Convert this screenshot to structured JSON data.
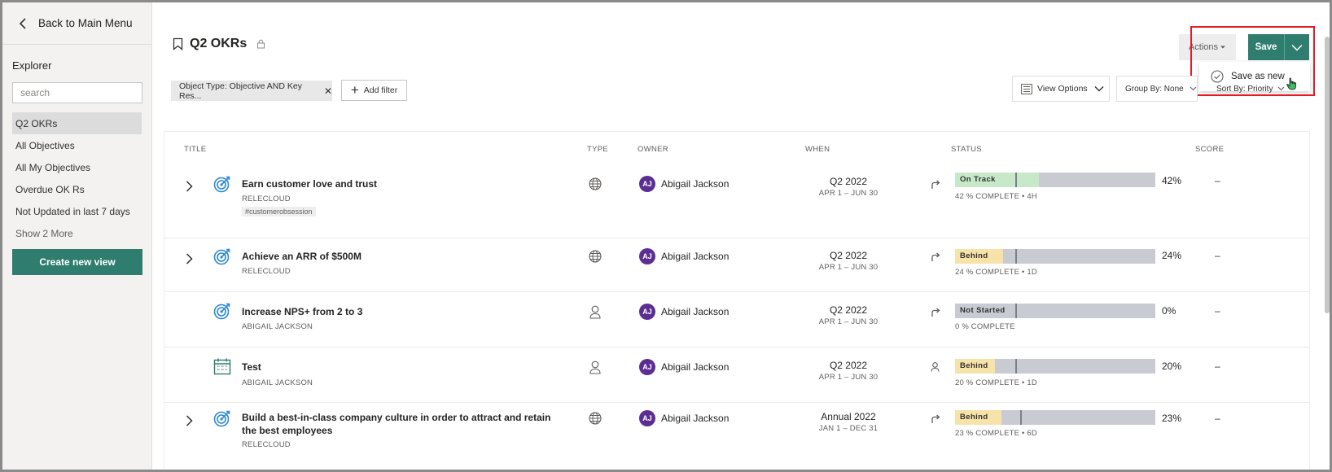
{
  "sidebar": {
    "back_label": "Back to Main Menu",
    "explorer_title": "Explorer",
    "search_placeholder": "search",
    "views": [
      "Q2 OKRs",
      "All Objectives",
      "All My Objectives",
      "Overdue OK Rs",
      "Not Updated in last 7 days"
    ],
    "show_more": "Show 2 More",
    "create_view": "Create new view"
  },
  "header": {
    "title": "Q2 OKRs",
    "actions": "Actions",
    "save": "Save",
    "save_as_new": "Save as new",
    "filter_chip": "Object Type: Objective AND Key Res...",
    "add_filter": "Add filter",
    "view_options": "View Options",
    "group_by": "Group By: None",
    "sort_by": "Sort By: Priority"
  },
  "table": {
    "columns": {
      "title": "TITLE",
      "type": "TYPE",
      "owner": "OWNER",
      "when": "WHEN",
      "status": "STATUS",
      "score": "SCORE"
    },
    "rows": [
      {
        "title": "Earn customer love and trust",
        "sub": "RELECLOUD",
        "tag": "#customerobsession",
        "owner_initials": "AJ",
        "owner": "Abigail Jackson",
        "period": "Q2 2022",
        "dates": "APR 1 – JUN 30",
        "status": "On Track",
        "status_color": "#c7e9c9",
        "progress": 42,
        "progress_text": "42 % COMPLETE • 4H",
        "pct": "42%",
        "score": "–"
      },
      {
        "title": "Achieve an ARR of $500M",
        "sub": "RELECLOUD",
        "owner_initials": "AJ",
        "owner": "Abigail Jackson",
        "period": "Q2 2022",
        "dates": "APR 1 – JUN 30",
        "status": "Behind",
        "status_color": "#f7e2a9",
        "progress": 24,
        "progress_text": "24 % COMPLETE • 1D",
        "pct": "24%",
        "score": "–"
      },
      {
        "title": "Increase NPS+ from 2 to 3",
        "sub": "ABIGAIL JACKSON",
        "owner_initials": "AJ",
        "owner": "Abigail Jackson",
        "period": "Q2 2022",
        "dates": "APR 1 – JUN 30",
        "status": "Not Started",
        "status_color": "#c8ccd2",
        "progress": 0,
        "progress_text": "0 % COMPLETE",
        "pct": "0%",
        "score": "–"
      },
      {
        "title": "Test",
        "sub": "ABIGAIL JACKSON",
        "owner_initials": "AJ",
        "owner": "Abigail Jackson",
        "period": "Q2 2022",
        "dates": "APR 1 – JUN 30",
        "status": "Behind",
        "status_color": "#f7e2a9",
        "progress": 20,
        "progress_text": "20 % COMPLETE • 1D",
        "pct": "20%",
        "score": "–"
      },
      {
        "title": "Build a best-in-class company culture in order to attract and retain the best employees",
        "sub": "RELECLOUD",
        "owner_initials": "AJ",
        "owner": "Abigail Jackson",
        "period": "Annual 2022",
        "dates": "JAN 1 – DEC 31",
        "status": "Behind",
        "status_color": "#f7e2a9",
        "progress": 23,
        "progress_text": "23 % COMPLETE • 6D",
        "pct": "23%",
        "score": "–"
      }
    ]
  },
  "colors": {
    "brand": "#2e7d6e",
    "avatar": "#5c2e91",
    "objective_icon": "#2b88d8",
    "highlight": "#e51b24"
  }
}
